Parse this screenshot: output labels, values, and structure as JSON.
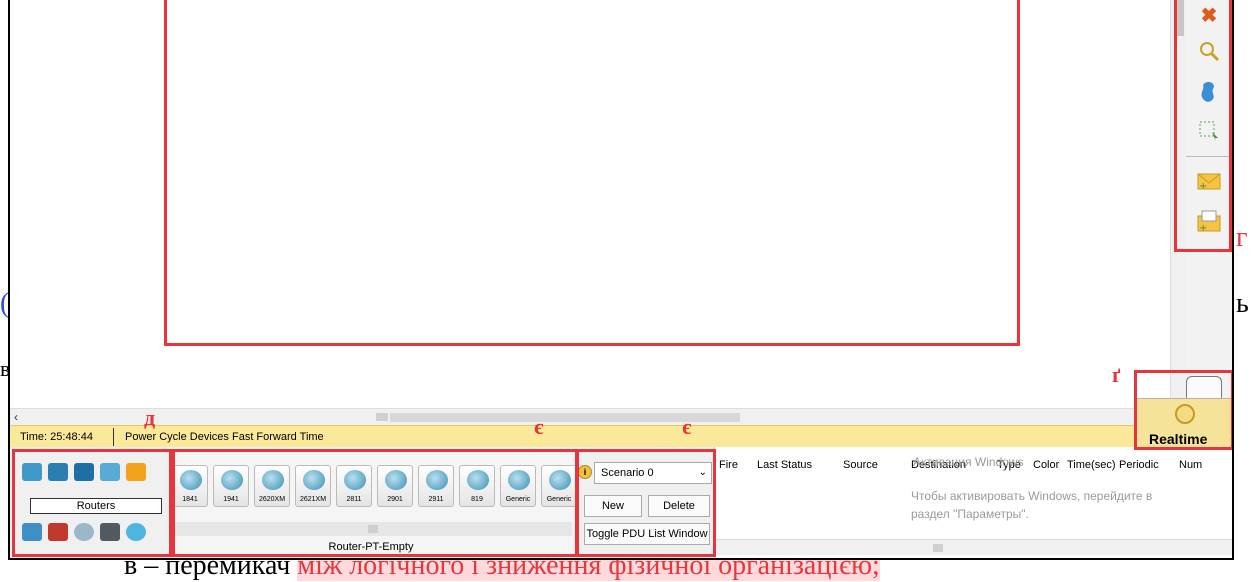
{
  "document": {
    "line_right_top": "г",
    "line_left_mid": "(",
    "line_right_mid": "ь",
    "line_left_small": "в",
    "bottom_prefix": "в – перемикач",
    "bottom_highlight": "між логічного і зниження фізичної організацією;"
  },
  "annotations": {
    "letter_d": "д",
    "letter_e1": "є",
    "letter_e2": "є",
    "letter_g": "ґ"
  },
  "statusbar": {
    "time": "Time: 25:48:44",
    "power_cycle": "Power Cycle Devices",
    "fast_forward": "Fast Forward Time"
  },
  "realtime": {
    "label": "Realtime"
  },
  "categories": {
    "selected": "Routers"
  },
  "devices": {
    "items": [
      "1841",
      "1941",
      "2620XM",
      "2621XM",
      "2811",
      "2901",
      "2911",
      "819",
      "Generic",
      "Generic"
    ],
    "selected_name": "Router-PT-Empty"
  },
  "scenario": {
    "selected": "Scenario 0",
    "new_label": "New",
    "delete_label": "Delete",
    "toggle_label": "Toggle PDU List Window"
  },
  "pdu_list": {
    "columns": [
      "Fire",
      "Last Status",
      "Source",
      "Destination",
      "Type",
      "Color",
      "Time(sec)",
      "Periodic",
      "Num"
    ],
    "watermark_title": "Активация Windows",
    "watermark_line1": "Чтобы активировать Windows, перейдите в",
    "watermark_line2": "раздел \"Параметры\"."
  },
  "icons": {
    "delete": "close-icon",
    "inspect": "magnifier-icon",
    "draw": "shape-icon",
    "resize": "resize-icon",
    "add_simple_pdu": "envelope-icon",
    "add_complex_pdu": "envelope-open-icon"
  },
  "colors": {
    "annotation": "#e8343c",
    "statusbar": "#fbe99a"
  }
}
